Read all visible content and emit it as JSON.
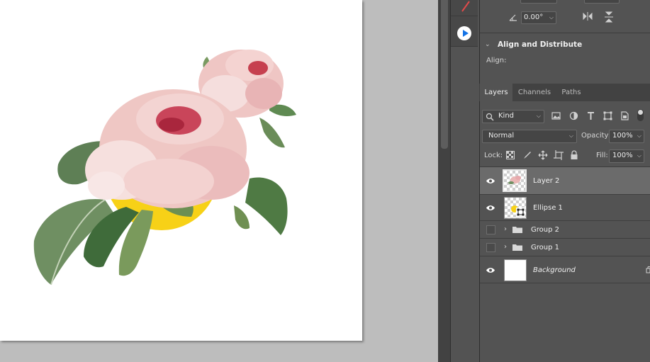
{
  "properties": {
    "angle_value": "0.00°",
    "align_distribute_title": "Align and Distribute",
    "align_label": "Align:"
  },
  "layers_panel": {
    "tabs": [
      {
        "label": "Layers",
        "active": true
      },
      {
        "label": "Channels",
        "active": false
      },
      {
        "label": "Paths",
        "active": false
      }
    ],
    "filter_kind": "Kind",
    "blend_mode": "Normal",
    "opacity_label": "Opacity:",
    "opacity_value": "100%",
    "lock_label": "Lock:",
    "fill_label": "Fill:",
    "fill_value": "100%",
    "layers": [
      {
        "name": "Layer 2",
        "visible": true,
        "selected": true,
        "type": "pixel"
      },
      {
        "name": "Ellipse 1",
        "visible": true,
        "selected": false,
        "type": "shape"
      },
      {
        "name": "Group 2",
        "visible": false,
        "selected": false,
        "type": "group"
      },
      {
        "name": "Group 1",
        "visible": false,
        "selected": false,
        "type": "group"
      },
      {
        "name": "Background",
        "visible": true,
        "selected": false,
        "type": "background"
      }
    ]
  },
  "colors": {
    "ellipse_fill": "#f7d117",
    "selected_row": "#6b6b6b",
    "panel_bg": "#535353",
    "accent_blue": "#1473e6"
  }
}
